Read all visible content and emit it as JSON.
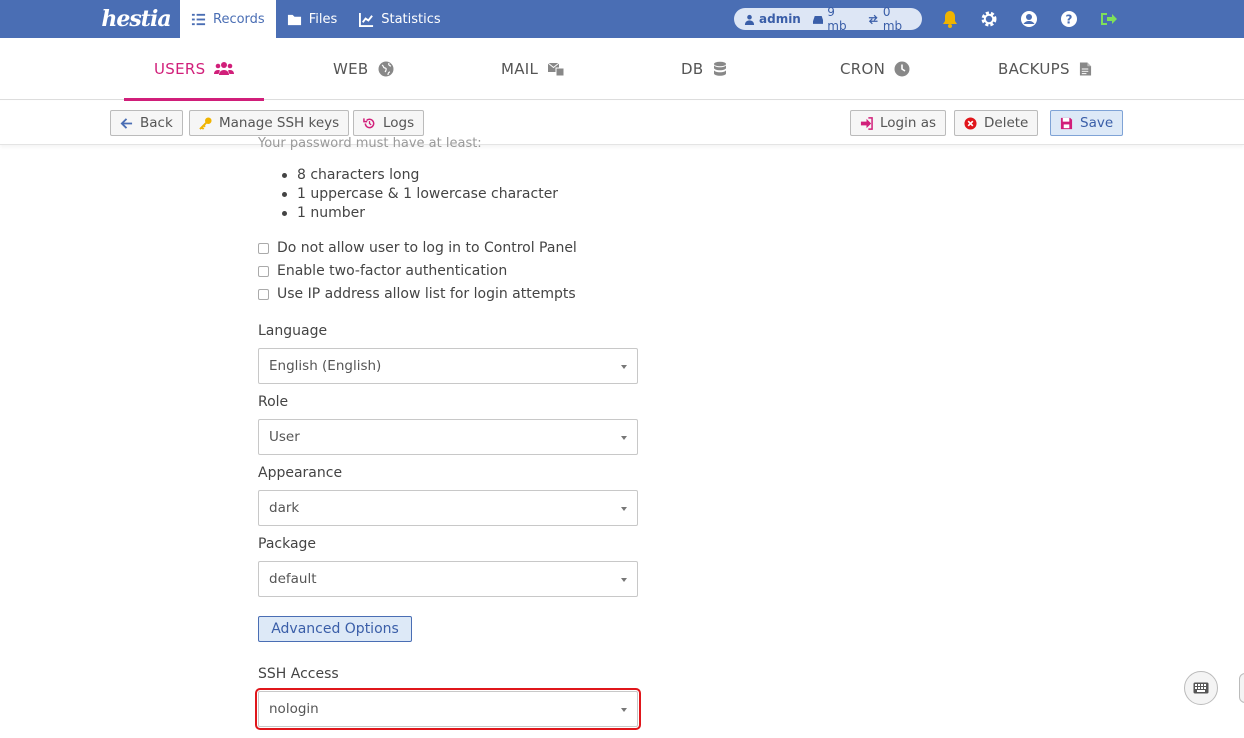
{
  "topbar": {
    "logo": "hestia",
    "nav": [
      {
        "label": "Records",
        "icon": "list-icon",
        "active": true
      },
      {
        "label": "Files",
        "icon": "folder-icon",
        "active": false
      },
      {
        "label": "Statistics",
        "icon": "chart-icon",
        "active": false
      }
    ],
    "quota": {
      "user": "admin",
      "disk": "9 mb",
      "bandwidth": "0 mb"
    },
    "icons": [
      "bell-icon",
      "gear-icon",
      "user-circle-icon",
      "help-icon",
      "logout-icon"
    ],
    "colors": {
      "bar": "#4a6eb4",
      "bell": "#f0b400",
      "logout": "#7ee05a"
    }
  },
  "tabs": [
    {
      "label": "USERS",
      "icon": "users-icon",
      "active": true
    },
    {
      "label": "WEB",
      "icon": "globe-icon",
      "active": false
    },
    {
      "label": "MAIL",
      "icon": "mail-icon",
      "active": false
    },
    {
      "label": "DB",
      "icon": "database-icon",
      "active": false
    },
    {
      "label": "CRON",
      "icon": "clock-icon",
      "active": false
    },
    {
      "label": "BACKUPS",
      "icon": "file-icon",
      "active": false
    }
  ],
  "toolbar": {
    "back": "Back",
    "ssh_keys": "Manage SSH keys",
    "logs": "Logs",
    "login_as": "Login as",
    "delete": "Delete",
    "save": "Save"
  },
  "form": {
    "password_note": "Your password must have at least:",
    "requirements": [
      "8 characters long",
      "1 uppercase & 1 lowercase character",
      "1 number"
    ],
    "checkboxes": [
      {
        "label": "Do not allow user to log in to Control Panel",
        "checked": false
      },
      {
        "label": "Enable two-factor authentication",
        "checked": false
      },
      {
        "label": "Use IP address allow list for login attempts",
        "checked": false
      }
    ],
    "language": {
      "label": "Language",
      "value": "English (English)"
    },
    "role": {
      "label": "Role",
      "value": "User"
    },
    "appearance": {
      "label": "Appearance",
      "value": "dark"
    },
    "package": {
      "label": "Package",
      "value": "default"
    },
    "advanced": "Advanced Options",
    "ssh_access": {
      "label": "SSH Access",
      "value": "nologin"
    }
  }
}
